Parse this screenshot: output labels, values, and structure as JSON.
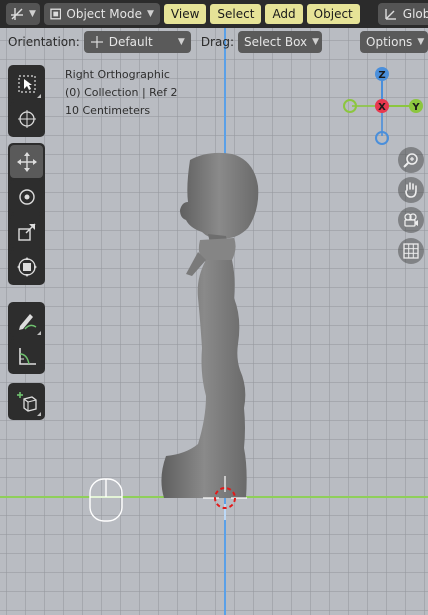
{
  "header": {
    "mode_label": "Object Mode",
    "menus": [
      "View",
      "Select",
      "Add",
      "Object"
    ],
    "transform_label": "Global"
  },
  "toolsettings": {
    "orientation_label": "Orientation:",
    "orientation_value": "Default",
    "drag_label": "Drag:",
    "drag_value": "Select Box",
    "options_label": "Options"
  },
  "overlay": {
    "view_name": "Right Orthographic",
    "collection": "(0) Collection | Ref 2",
    "scale": "10 Centimeters"
  },
  "gizmo": {
    "z_label": "Z",
    "x_label": "X",
    "y_label": "Y"
  },
  "colors": {
    "accent": "#4772b3",
    "menu_bg": "#e6e397",
    "axis_x": "#8fcf5a",
    "axis_z": "#5aa0e8",
    "gizmo_red": "#e8384f",
    "gizmo_green": "#8cc63f",
    "gizmo_blue": "#4a8fdb"
  },
  "toolbar_icons": [
    "select-box-icon",
    "cursor-icon",
    "move-icon",
    "rotate-icon",
    "scale-icon",
    "transform-icon",
    "annotate-icon",
    "measure-icon",
    "add-cube-icon"
  ],
  "nav_icons": [
    "zoom-icon",
    "hand-pan-icon",
    "camera-icon",
    "grid-icon"
  ]
}
